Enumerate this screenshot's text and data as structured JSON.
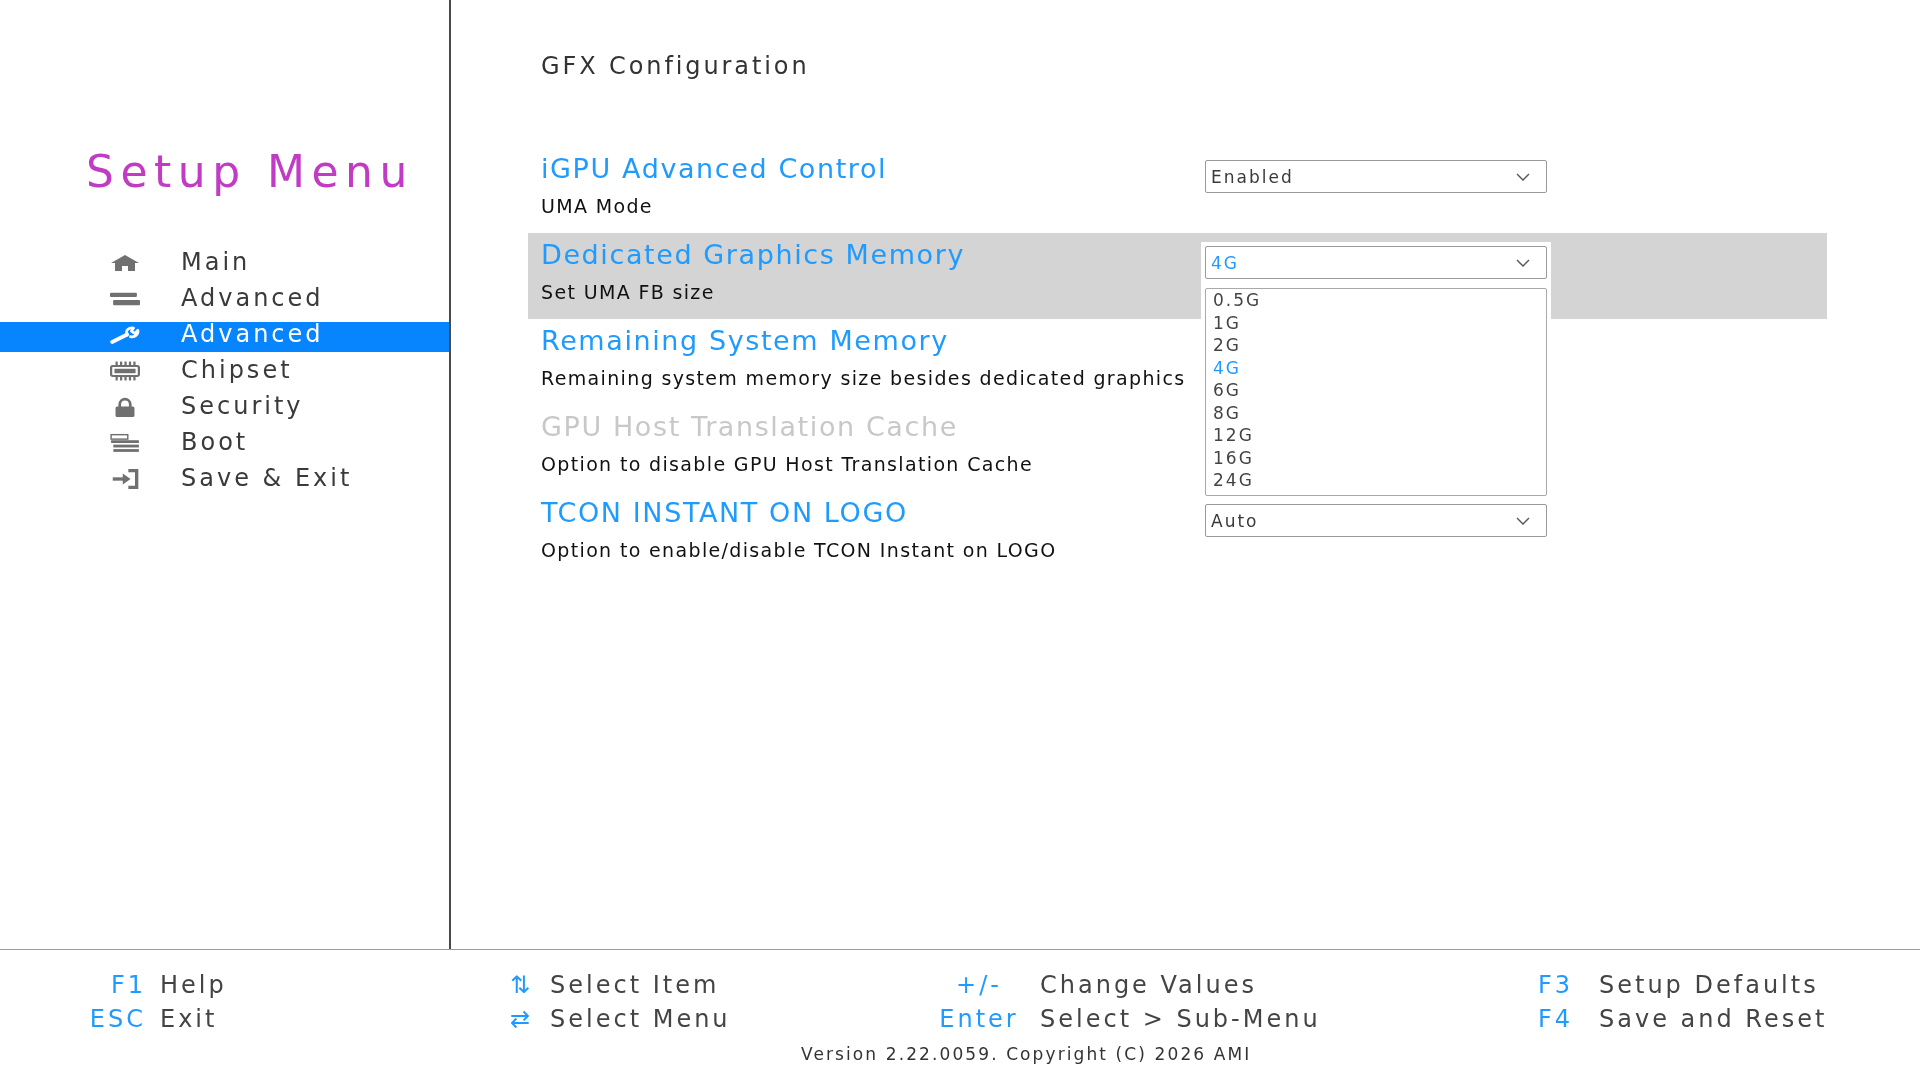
{
  "sidebar": {
    "title": "Setup Menu",
    "items": [
      {
        "label": "Main",
        "selected": false
      },
      {
        "label": "Advanced",
        "selected": false
      },
      {
        "label": "Advanced",
        "selected": true
      },
      {
        "label": "Chipset",
        "selected": false
      },
      {
        "label": "Security",
        "selected": false
      },
      {
        "label": "Boot",
        "selected": false
      },
      {
        "label": "Save & Exit",
        "selected": false
      }
    ]
  },
  "page": {
    "title": "GFX Configuration",
    "settings": [
      {
        "title": "iGPU Advanced Control",
        "help": "UMA Mode",
        "selected": false,
        "disabled": false,
        "dropdown": {
          "value": "Enabled",
          "expanded": false
        }
      },
      {
        "title": "Dedicated Graphics Memory",
        "help": "Set UMA FB size",
        "selected": true,
        "disabled": false,
        "dropdown": {
          "value": "4G",
          "expanded": true,
          "options": [
            {
              "label": "0.5G",
              "selected": false
            },
            {
              "label": "1G",
              "selected": false
            },
            {
              "label": "2G",
              "selected": false
            },
            {
              "label": "4G",
              "selected": true
            },
            {
              "label": "6G",
              "selected": false
            },
            {
              "label": "8G",
              "selected": false
            },
            {
              "label": "12G",
              "selected": false
            },
            {
              "label": "16G",
              "selected": false
            },
            {
              "label": "24G",
              "selected": false
            }
          ]
        }
      },
      {
        "title": "Remaining System Memory",
        "help": "Remaining system memory size besides dedicated graphics",
        "selected": false,
        "disabled": false
      },
      {
        "title": "GPU Host Translation Cache",
        "help": "Option to disable GPU Host Translation Cache",
        "selected": false,
        "disabled": true
      },
      {
        "title": "TCON INSTANT ON LOGO",
        "help": "Option to enable/disable TCON Instant on LOGO",
        "selected": false,
        "disabled": false,
        "dropdown": {
          "value": "Auto",
          "expanded": false
        }
      }
    ]
  },
  "footer": {
    "hints": [
      {
        "key": "F1",
        "label": "Help"
      },
      {
        "key": "⇅",
        "label": "Select Item"
      },
      {
        "key": "+/-",
        "label": "Change Values"
      },
      {
        "key": "F3",
        "label": "Setup Defaults"
      },
      {
        "key": "ESC",
        "label": "Exit"
      },
      {
        "key": "⇄",
        "label": "Select Menu"
      },
      {
        "key": "Enter",
        "label": "Select > Sub-Menu"
      },
      {
        "key": "F4",
        "label": "Save and Reset"
      }
    ],
    "version": "Version 2.22.0059. Copyright (C) 2026 AMI"
  }
}
